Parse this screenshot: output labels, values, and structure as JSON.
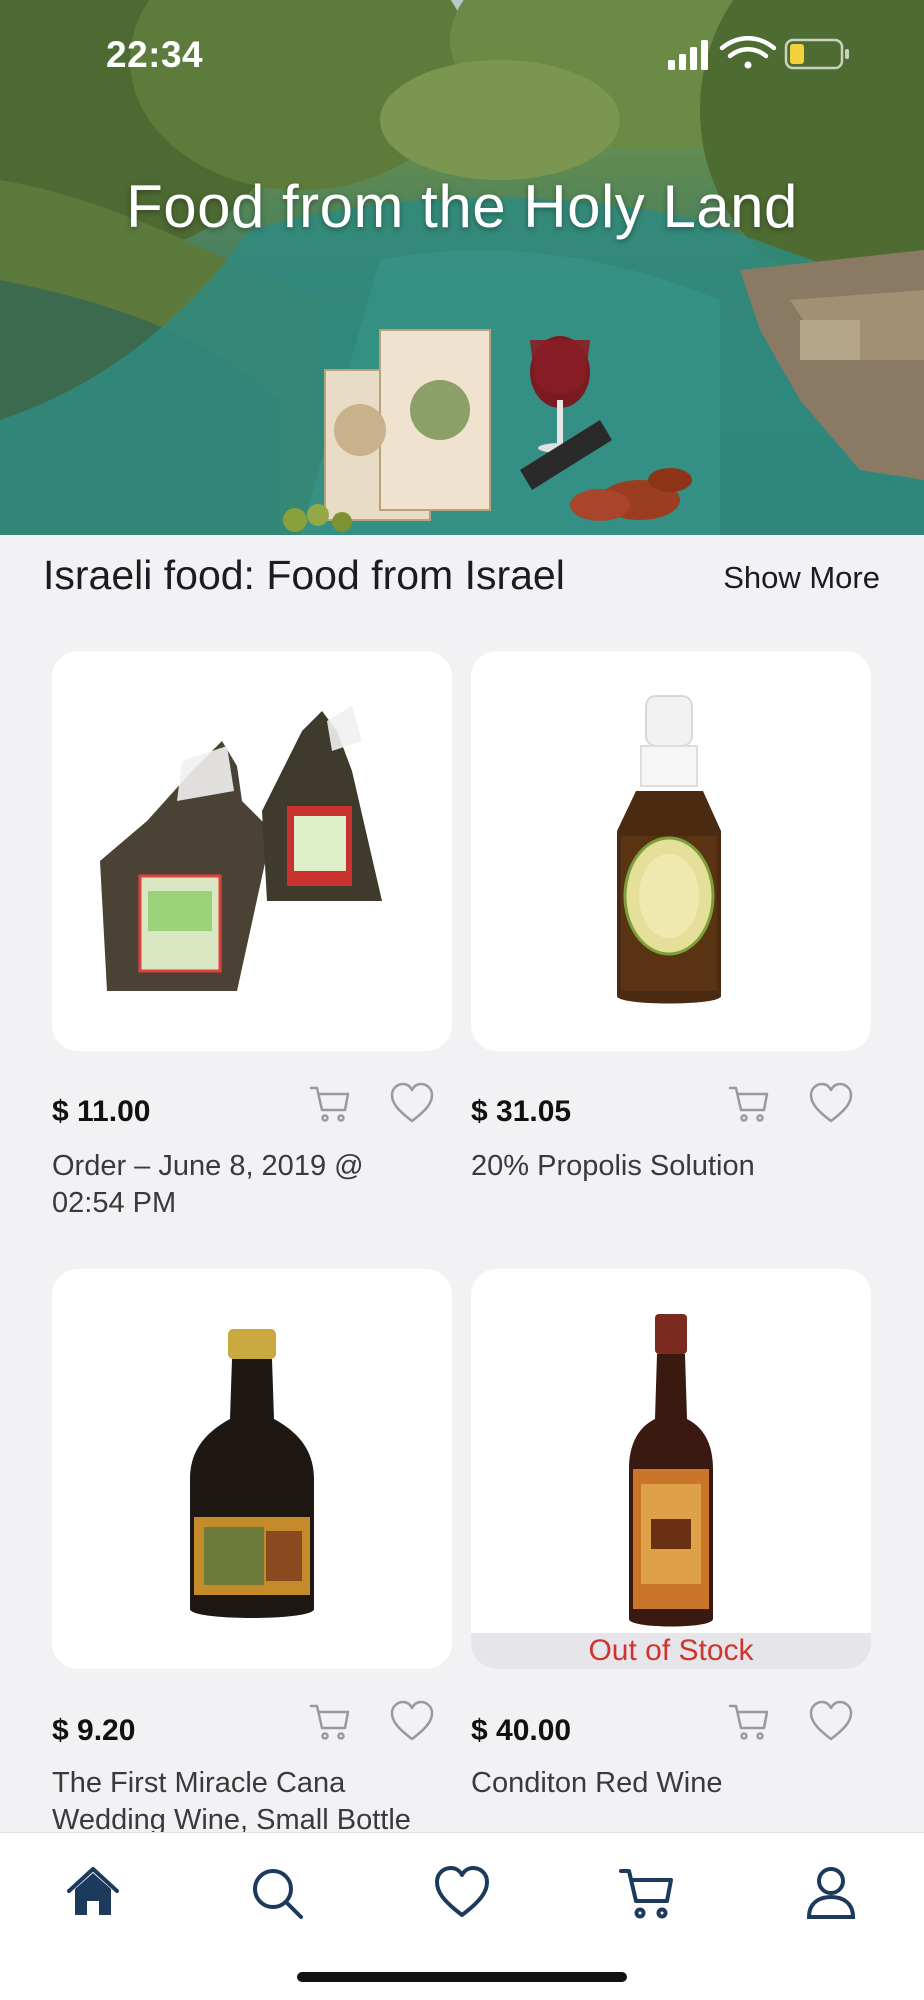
{
  "status_bar": {
    "time": "22:34"
  },
  "hero": {
    "title": "Food from the Holy Land"
  },
  "section": {
    "title": "Israeli food: Food from Israel",
    "show_more": "Show More"
  },
  "products": [
    {
      "price": "$ 11.00",
      "name": "Order – June 8, 2019 @ 02:54 PM",
      "out_of_stock": false
    },
    {
      "price": "$ 31.05",
      "name": "20% Propolis Solution",
      "out_of_stock": false
    },
    {
      "price": "$ 9.20",
      "name": "The First Miracle Cana Wedding Wine, Small Bottle",
      "out_of_stock": false
    },
    {
      "price": "$ 40.00",
      "name": "Conditon Red Wine",
      "out_of_stock": true,
      "badge": "Out of Stock"
    }
  ],
  "tabbar": {
    "items": [
      "home-icon",
      "search-icon",
      "heart-icon",
      "cart-icon",
      "profile-icon"
    ],
    "active": "home-icon"
  },
  "colors": {
    "accent": "#1b3a5c",
    "out_of_stock_text": "#d0342c",
    "icon_gray": "#9a9a9e"
  }
}
